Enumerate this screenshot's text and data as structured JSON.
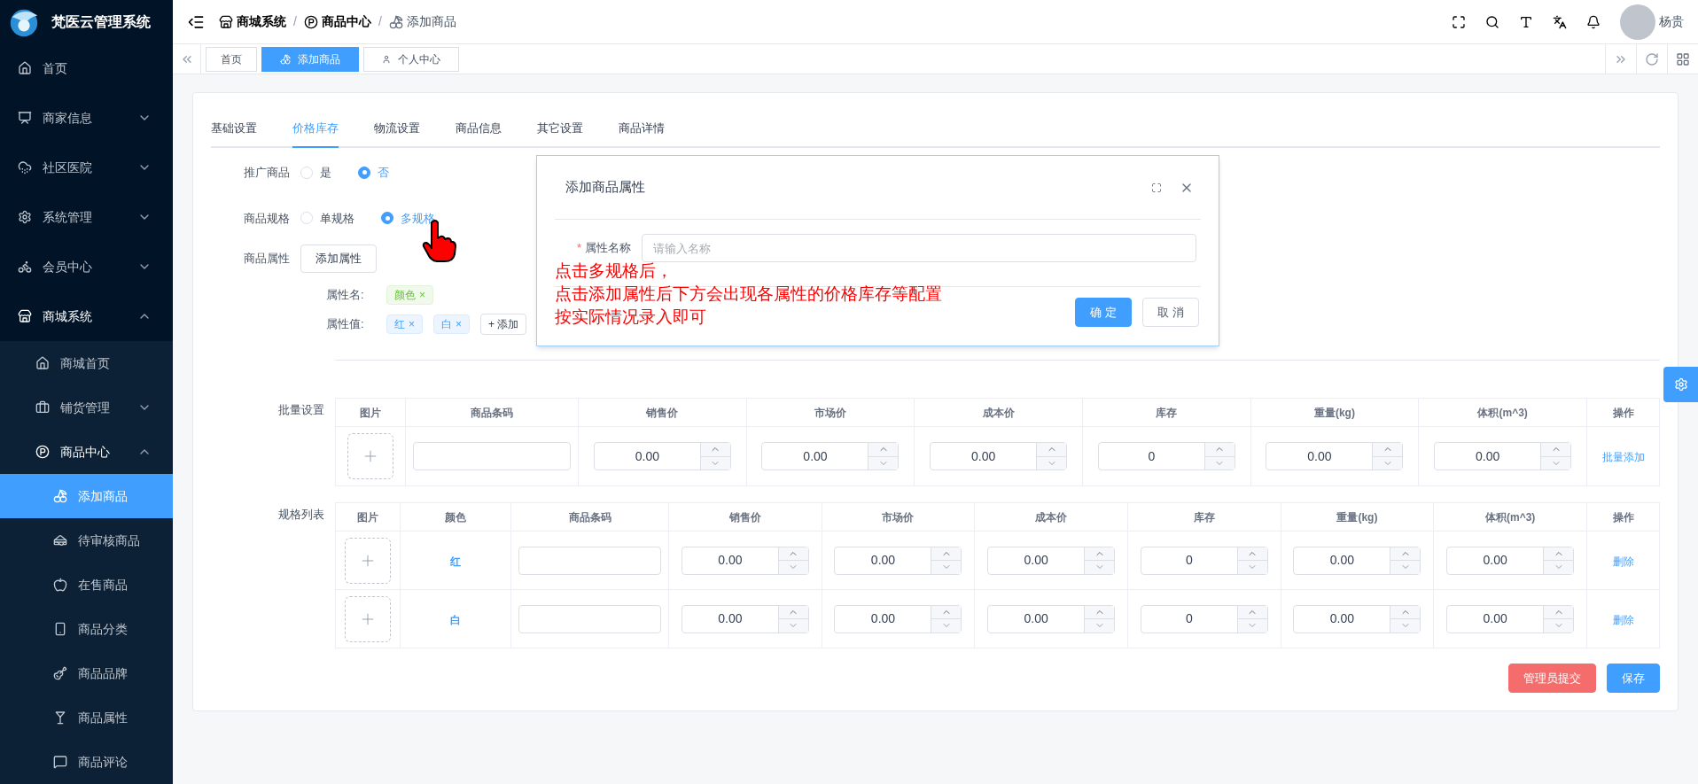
{
  "app": {
    "title": "梵医云管理系统"
  },
  "sidebar": {
    "items": [
      {
        "label": "首页"
      },
      {
        "label": "商家信息",
        "expanded": false
      },
      {
        "label": "社区医院",
        "expanded": false
      },
      {
        "label": "系统管理",
        "expanded": false
      },
      {
        "label": "会员中心",
        "expanded": false
      },
      {
        "label": "商城系统",
        "expanded": true,
        "children": [
          {
            "label": "商城首页"
          },
          {
            "label": "铺货管理",
            "expanded": false
          },
          {
            "label": "商品中心",
            "expanded": true,
            "children": [
              {
                "label": "添加商品",
                "selected": true
              },
              {
                "label": "待审核商品",
                "selected": false
              },
              {
                "label": "在售商品",
                "selected": false
              },
              {
                "label": "商品分类",
                "selected": false
              },
              {
                "label": "商品品牌",
                "selected": false
              },
              {
                "label": "商品属性",
                "selected": false
              },
              {
                "label": "商品评论",
                "selected": false
              }
            ]
          }
        ]
      }
    ]
  },
  "breadcrumb": {
    "items": [
      "商城系统",
      "商品中心",
      "添加商品"
    ],
    "separator": "/"
  },
  "user": {
    "name": "杨贵"
  },
  "tags": [
    {
      "label": "首页",
      "selected": false
    },
    {
      "label": "添加商品",
      "selected": true
    },
    {
      "label": "个人中心",
      "selected": false
    }
  ],
  "form_tabs": [
    {
      "label": "基础设置",
      "selected": false
    },
    {
      "label": "价格库存",
      "selected": true
    },
    {
      "label": "物流设置",
      "selected": false
    },
    {
      "label": "商品信息",
      "selected": false
    },
    {
      "label": "其它设置",
      "selected": false
    },
    {
      "label": "商品详情",
      "selected": false
    }
  ],
  "radio_rows": [
    {
      "label": "推广商品",
      "options": [
        {
          "label": "是",
          "selected": false
        },
        {
          "label": "否",
          "selected": true
        }
      ]
    },
    {
      "label": "商品规格",
      "options": [
        {
          "label": "单规格",
          "selected": false
        },
        {
          "label": "多规格",
          "selected": true
        }
      ]
    }
  ],
  "attributes": {
    "label": "商品属性",
    "button": "添加属性",
    "name_label": "属性名:",
    "names": [
      "颜色"
    ],
    "value_label": "属性值:",
    "values": [
      "红",
      "白"
    ],
    "add_button": "+ 添加",
    "close_mark": "×"
  },
  "batch": {
    "label": "批量设置",
    "columns": [
      "图片",
      "商品条码",
      "销售价",
      "市场价",
      "成本价",
      "库存",
      "重量(kg)",
      "体积(m^3)",
      "操作"
    ],
    "row": {
      "prices": [
        "0.00",
        "0.00",
        "0.00",
        "0",
        "0.00",
        "0.00"
      ],
      "action": "批量添加"
    }
  },
  "spec": {
    "label": "规格列表",
    "columns": [
      "图片",
      "颜色",
      "商品条码",
      "销售价",
      "市场价",
      "成本价",
      "库存",
      "重量(kg)",
      "体积(m^3)",
      "操作"
    ],
    "rows": [
      {
        "value": "红",
        "prices": [
          "0.00",
          "0.00",
          "0.00",
          "0",
          "0.00",
          "0.00"
        ],
        "action": "删除"
      },
      {
        "value": "白",
        "prices": [
          "0.00",
          "0.00",
          "0.00",
          "0",
          "0.00",
          "0.00"
        ],
        "action": "删除"
      }
    ]
  },
  "footer_buttons": [
    {
      "label": "管理员提交",
      "kind": "danger"
    },
    {
      "label": "保存",
      "kind": "primary"
    }
  ],
  "dialog": {
    "title": "添加商品属性",
    "field_label": "属性名称",
    "required_mark": "*",
    "placeholder": "请输入名称",
    "buttons": [
      {
        "label": "确 定",
        "kind": "primary"
      },
      {
        "label": "取 消",
        "kind": "default"
      }
    ]
  },
  "annotation": [
    "点击多规格后，",
    "点击添加属性后下方会出现各属性的价格库存等配置",
    "按实际情况录入即可"
  ]
}
